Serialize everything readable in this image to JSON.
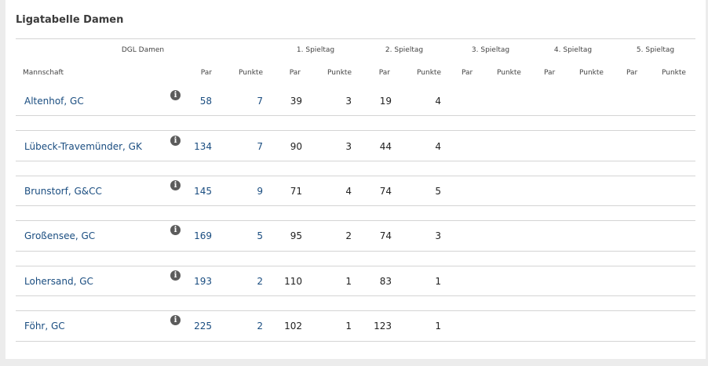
{
  "title": "Ligatabelle Damen",
  "header": {
    "league": "DGL Damen",
    "matchdays": [
      "1. Spieltag",
      "2. Spieltag",
      "3. Spieltag",
      "4. Spieltag",
      "5. Spieltag"
    ],
    "team_col": "Mannschaft",
    "par": "Par",
    "punkte": "Punkte"
  },
  "rows": [
    {
      "team": "Altenhof, GC",
      "par": "58",
      "punkte": "7",
      "md1_par": "39",
      "md1_punkte": "3",
      "md2_par": "19",
      "md2_punkte": "4"
    },
    {
      "team": "Lübeck-Travemünder, GK",
      "par": "134",
      "punkte": "7",
      "md1_par": "90",
      "md1_punkte": "3",
      "md2_par": "44",
      "md2_punkte": "4"
    },
    {
      "team": "Brunstorf, G&CC",
      "par": "145",
      "punkte": "9",
      "md1_par": "71",
      "md1_punkte": "4",
      "md2_par": "74",
      "md2_punkte": "5"
    },
    {
      "team": "Großensee, GC",
      "par": "169",
      "punkte": "5",
      "md1_par": "95",
      "md1_punkte": "2",
      "md2_par": "74",
      "md2_punkte": "3"
    },
    {
      "team": "Lohersand, GC",
      "par": "193",
      "punkte": "2",
      "md1_par": "110",
      "md1_punkte": "1",
      "md2_par": "83",
      "md2_punkte": "1"
    },
    {
      "team": "Föhr, GC",
      "par": "225",
      "punkte": "2",
      "md1_par": "102",
      "md1_punkte": "1",
      "md2_par": "123",
      "md2_punkte": "1"
    }
  ],
  "info_icon": "info-icon",
  "info_glyph": "i",
  "colors": {
    "link": "#1a4d80",
    "divider": "#d4d4d4",
    "background": "#ececec"
  }
}
